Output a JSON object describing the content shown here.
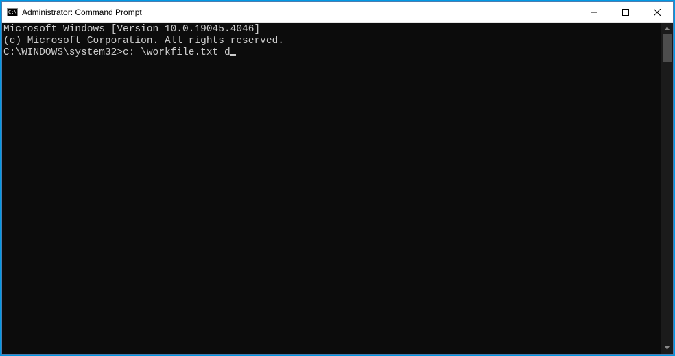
{
  "window": {
    "title": "Administrator: Command Prompt"
  },
  "terminal": {
    "line1": "Microsoft Windows [Version 10.0.19045.4046]",
    "line2": "(c) Microsoft Corporation. All rights reserved.",
    "blank": "",
    "prompt": "C:\\WINDOWS\\system32>",
    "input": "c: \\workfile.txt d"
  }
}
